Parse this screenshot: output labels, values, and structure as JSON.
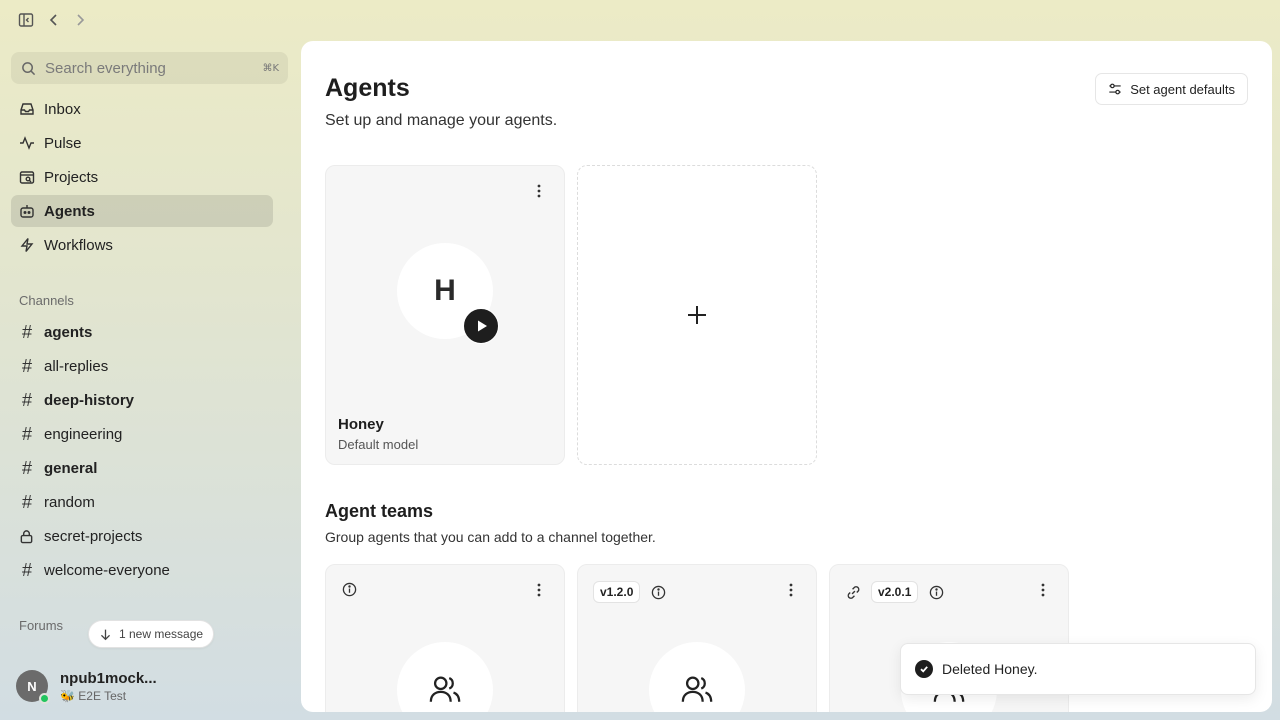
{
  "search": {
    "placeholder": "Search everything",
    "shortcut": "⌘K"
  },
  "nav": [
    {
      "label": "Inbox",
      "icon": "inbox-icon"
    },
    {
      "label": "Pulse",
      "icon": "pulse-icon"
    },
    {
      "label": "Projects",
      "icon": "projects-icon"
    },
    {
      "label": "Agents",
      "icon": "agents-icon",
      "active": true
    },
    {
      "label": "Workflows",
      "icon": "workflows-icon"
    }
  ],
  "channels_label": "Channels",
  "channels": [
    {
      "label": "agents",
      "bold": true
    },
    {
      "label": "all-replies",
      "bold": false
    },
    {
      "label": "deep-history",
      "bold": true
    },
    {
      "label": "engineering",
      "bold": false
    },
    {
      "label": "general",
      "bold": true
    },
    {
      "label": "random",
      "bold": false
    },
    {
      "label": "secret-projects",
      "bold": false,
      "private": true
    },
    {
      "label": "welcome-everyone",
      "bold": false
    }
  ],
  "forums_label": "Forums",
  "new_message": "1 new message",
  "user": {
    "initial": "N",
    "name": "npub1mock...",
    "status": "🐝 E2E Test"
  },
  "page": {
    "title": "Agents",
    "subtitle": "Set up and manage your agents.",
    "defaults_button": "Set agent defaults"
  },
  "agent": {
    "initial": "H",
    "name": "Honey",
    "model": "Default model"
  },
  "teams": {
    "title": "Agent teams",
    "subtitle": "Group agents that you can add to a channel together.",
    "cards": [
      {
        "version": "",
        "link": false
      },
      {
        "version": "v1.2.0",
        "link": false
      },
      {
        "version": "v2.0.1",
        "link": true
      }
    ]
  },
  "toast": {
    "message": "Deleted Honey."
  },
  "colors": {
    "status_online": "#22c55e",
    "accent_dark": "#1e1e1e"
  }
}
